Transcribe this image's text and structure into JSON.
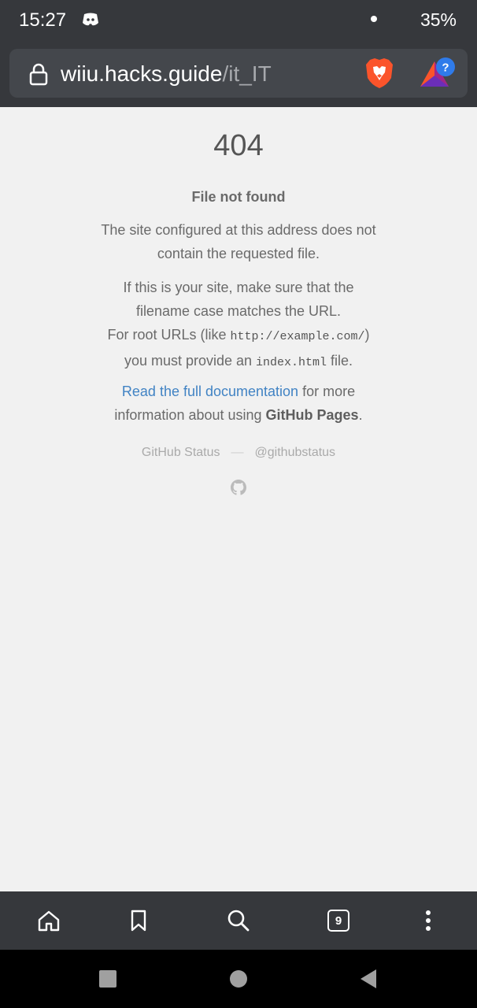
{
  "status_bar": {
    "time": "15:27",
    "battery": "35%"
  },
  "browser": {
    "url_host": "wiiu.hacks.guide",
    "url_path": "/it_IT",
    "tab_count": "9"
  },
  "page": {
    "code": "404",
    "title": "File not found",
    "para1": {
      "line1": "The site configured at this address does not",
      "line2": "contain the requested file."
    },
    "para2": {
      "line1": "If this is your site, make sure that the",
      "line2": "filename case matches the URL.",
      "line3_prefix": "For root URLs (like ",
      "line3_code": "http://example.com/",
      "line3_suffix": ")",
      "line4_prefix": "you must provide an ",
      "line4_code": "index.html",
      "line4_suffix": " file."
    },
    "para3": {
      "link": "Read the full documentation",
      "line1_suffix": " for more",
      "line2_prefix": "information about using ",
      "line2_strong": "GitHub Pages",
      "line2_suffix": "."
    },
    "footer": {
      "status_link": "GitHub Status",
      "separator": "—",
      "twitter_link": "@githubstatus"
    }
  },
  "colors": {
    "chrome": "#36383c",
    "link": "#4183c4",
    "brave_orange": "#fb542b"
  },
  "icons": [
    "discord-icon",
    "lock-icon",
    "brave-shield-icon",
    "brave-rewards-icon",
    "github-icon",
    "home-icon",
    "bookmark-icon",
    "search-icon",
    "more-icon",
    "recents-icon",
    "home-circle-icon",
    "back-icon"
  ]
}
